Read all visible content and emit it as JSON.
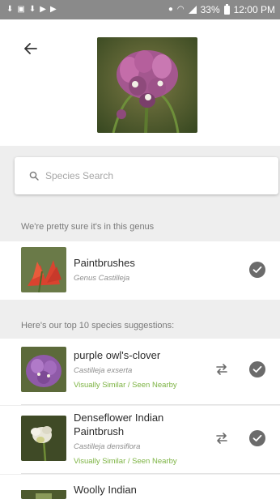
{
  "status_bar": {
    "battery": "33%",
    "time": "12:00 PM"
  },
  "search": {
    "placeholder": "Species Search"
  },
  "genus_section": {
    "label": "We're pretty sure it's in this genus",
    "item": {
      "name": "Paintbrushes",
      "subtitle": "Genus Castilleja"
    }
  },
  "species_section": {
    "label": "Here's our top 10 species suggestions:",
    "items": [
      {
        "name": "purple owl's-clover",
        "scientific": "Castilleja exserta",
        "tag": "Visually Similar / Seen Nearby"
      },
      {
        "name_line1": "Denseflower Indian",
        "name_line2": "Paintbrush",
        "scientific": "Castilleja densiflora",
        "tag": "Visually Similar / Seen Nearby"
      },
      {
        "name": "Woolly Indian"
      }
    ]
  },
  "colors": {
    "accent_green": "#7cb342",
    "check_grey": "#6b6b6b",
    "section_bg": "#eeeeee"
  },
  "icons": [
    "back-arrow-icon",
    "search-icon",
    "check-icon",
    "swap-icon"
  ]
}
